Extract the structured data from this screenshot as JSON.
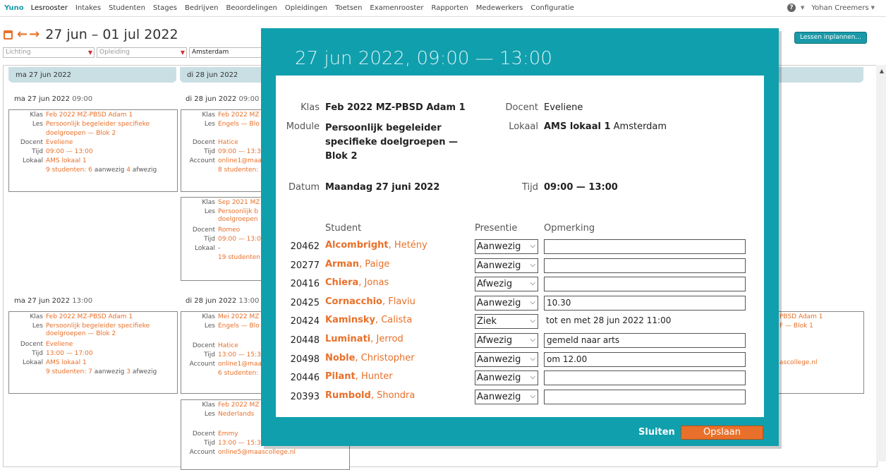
{
  "nav": {
    "brand": "Yuno",
    "items": [
      "Lesrooster",
      "Intakes",
      "Studenten",
      "Stages",
      "Bedrijven",
      "Beoordelingen",
      "Opleidingen",
      "Toetsen",
      "Examenrooster",
      "Rapporten",
      "Medewerkers",
      "Configuratie"
    ],
    "help": "?",
    "user": "Yohan Creemers"
  },
  "header": {
    "week": "27 jun – 01 jul 2022",
    "prev": "←",
    "next": "→",
    "plan_button": "Lessen inplannen..."
  },
  "filters": {
    "lichting": "Lichting",
    "opleiding": "Opleiding",
    "locatie": "Amsterdam"
  },
  "days": {
    "mon": "ma 27 jun 2022",
    "tue": "di 28 jun 2022"
  },
  "slots": {
    "mon_am_date": "ma 27 jun 2022",
    "mon_am_time": "09:00",
    "tue_am_date": "di 28 jun 2022",
    "tue_am_time": "09:00",
    "mon_pm_date": "ma 27 jun 2022",
    "mon_pm_time": "13:00",
    "tue_pm_date": "di 28 jun 2022",
    "tue_pm_time": "13:00"
  },
  "labels": {
    "klas": "Klas",
    "les": "Les",
    "docent": "Docent",
    "tijd": "Tijd",
    "lokaal": "Lokaal",
    "account": "Account"
  },
  "cards": {
    "c1": {
      "klas": "Feb 2022 MZ-PBSD Adam 1",
      "les1": "Persoonlijk begeleider specifieke",
      "les2": "doelgroepen — Blok 2",
      "docent": "Eveliene",
      "tijd": "09:00 — 13:00",
      "lokaal": "AMS lokaal 1",
      "s_a": "9 studenten",
      "s_b": ": 6",
      "s_c": "aanwezig",
      "s_d": "4",
      "s_e": "afwezig"
    },
    "c2": {
      "klas": "Feb 2022 MZ",
      "les": "Engels — Blo",
      "docent": "Hatice",
      "tijd": "09:00 — 13:3",
      "account": "online1@maa",
      "studenten": "8 studenten:"
    },
    "c3": {
      "klas": "Sep 2021 MZ",
      "les1": "Persoonlijk b",
      "les2": "doelgroepen",
      "docent": "Romeo",
      "tijd": "09:00 — 13:0",
      "lokaal": "-",
      "studenten": "19 studenten"
    },
    "c4": {
      "klas": "Feb 2022 MZ-PBSD Adam 1",
      "les1": "Persoonlijk begeleider specifieke",
      "les2": "doelgroepen — Blok 2",
      "docent": "Eveliene",
      "tijd": "13:00 — 17:00",
      "lokaal": "AMS lokaal 1",
      "s_a": "9 studenten",
      "s_b": ": 7",
      "s_c": "aanwezig",
      "s_d": "3",
      "s_e": "afwezig"
    },
    "c5": {
      "klas": "Mei 2022 MZ",
      "les": "Engels — Blo",
      "docent": "Hatice",
      "tijd": "13:00 — 15:3",
      "account": "online1@maa",
      "studenten": "6 studenten:"
    },
    "c6": {
      "klas": "Feb 2022 MZ",
      "les": "Nederlands",
      "docent": "Emmy",
      "tijd": "13:00 — 15:3",
      "account": "online5@maascollege.nl"
    },
    "c7": {
      "line1": "PBSD Adam 1",
      "line2": "F — Blok 1",
      "line3": "ascollege.nl"
    }
  },
  "modal": {
    "title": "27 jun 2022, 09:00 — 13:00",
    "klas_label": "Klas",
    "klas": "Feb 2022 MZ-PBSD Adam 1",
    "module_label": "Module",
    "module1": "Persoonlijk begeleider",
    "module2": "specifieke doelgroepen —",
    "module3": "Blok 2",
    "docent_label": "Docent",
    "docent": "Eveliene",
    "lokaal_label": "Lokaal",
    "lokaal": "AMS lokaal 1",
    "lokaal_loc": "Amsterdam",
    "datum_label": "Datum",
    "datum": "Maandag 27 juni 2022",
    "tijd_label": "Tijd",
    "tijd": "09:00 — 13:00",
    "col_student": "Student",
    "col_presentie": "Presentie",
    "col_opmerking": "Opmerking",
    "students": [
      {
        "nr": "20462",
        "last": "Alcombright",
        "first": ", Hetény",
        "status": "Aanwezig",
        "remark": ""
      },
      {
        "nr": "20277",
        "last": "Arman",
        "first": ", Paige",
        "status": "Aanwezig",
        "remark": ""
      },
      {
        "nr": "20416",
        "last": "Chiera",
        "first": ", Jonas",
        "status": "Afwezig",
        "remark": ""
      },
      {
        "nr": "20425",
        "last": "Cornacchio",
        "first": ", Flaviu",
        "status": "Aanwezig",
        "remark": "10.30"
      },
      {
        "nr": "20424",
        "last": "Kaminsky",
        "first": ", Calista",
        "status": "Ziek",
        "remark": "tot en met 28 jun 2022 11:00"
      },
      {
        "nr": "20448",
        "last": "Luminati",
        "first": ", Jerrod",
        "status": "Afwezig",
        "remark": "gemeld naar arts"
      },
      {
        "nr": "20498",
        "last": "Noble",
        "first": ", Christopher",
        "status": "Aanwezig",
        "remark": "om 12.00"
      },
      {
        "nr": "20446",
        "last": "Pilant",
        "first": ", Hunter",
        "status": "Aanwezig",
        "remark": ""
      },
      {
        "nr": "20393",
        "last": "Rumbold",
        "first": ", Shondra",
        "status": "Aanwezig",
        "remark": ""
      }
    ],
    "close": "Sluiten",
    "save": "Opslaan"
  }
}
